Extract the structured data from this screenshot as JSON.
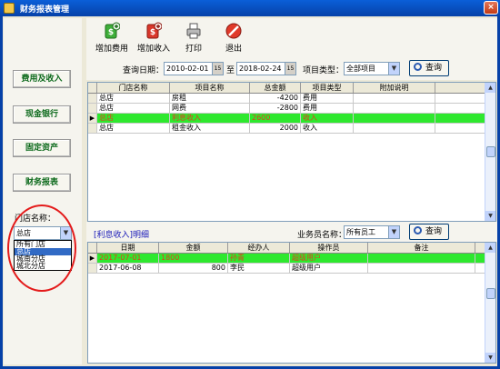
{
  "window": {
    "title": "财务报表管理",
    "close_glyph": "×"
  },
  "nav": [
    "费用及收入",
    "现金银行",
    "固定资产",
    "财务报表"
  ],
  "store": {
    "label": "门店名称：",
    "selected": "总店",
    "options": [
      "所有门店",
      "总店",
      "城南分店",
      "城北分店"
    ],
    "highlighted_index": 1
  },
  "toolbar": [
    {
      "label": "增加费用",
      "icon": "add-expense-icon"
    },
    {
      "label": "增加收入",
      "icon": "add-income-icon"
    },
    {
      "label": "打印",
      "icon": "printer-icon"
    },
    {
      "label": "退出",
      "icon": "exit-icon"
    }
  ],
  "query": {
    "date_label": "查询日期：",
    "date_from": "2010-02-01",
    "to_label": "至",
    "date_to": "2018-02-24",
    "calendar_glyph": "15",
    "type_label": "项目类型：",
    "type_value": "全部项目",
    "button": "查询"
  },
  "main_table": {
    "columns": [
      "门店名称",
      "项目名称",
      "总金额",
      "项目类型",
      "附加说明"
    ],
    "rows": [
      [
        "总店",
        "房租",
        "-4200",
        "费用",
        ""
      ],
      [
        "总店",
        "网费",
        "-2800",
        "费用",
        ""
      ],
      [
        "总店",
        "利息收入",
        "2600",
        "收入",
        ""
      ],
      [
        "总店",
        "租金收入",
        "2000",
        "收入",
        ""
      ]
    ],
    "current_row": 2,
    "row_pointer": "▶"
  },
  "detail": {
    "label": "[利息收入]明细",
    "salesman_label": "业务员名称：",
    "salesman_value": "所有员工",
    "button": "查询",
    "columns": [
      "日期",
      "金额",
      "经办人",
      "操作员",
      "备注"
    ],
    "rows": [
      [
        "2017-07-01",
        "1800",
        "孙青",
        "超级用户",
        ""
      ],
      [
        "2017-06-08",
        "800",
        "李民",
        "超级用户",
        ""
      ]
    ],
    "current_row": 0
  },
  "colors": {
    "highlight_row": "#2ee82e",
    "highlight_text": "#e23c1e",
    "nav_text": "#0d6a1c",
    "annotation_circle": "#e41b1b"
  }
}
